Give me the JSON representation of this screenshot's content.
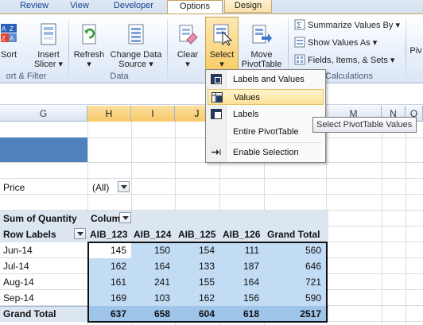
{
  "ribbon": {
    "tabs": [
      "Review",
      "View",
      "Developer",
      "Options",
      "Design"
    ],
    "buttons": {
      "sort": "Sort",
      "insert_slicer": [
        "Insert",
        "Slicer ▾"
      ],
      "refresh": [
        "Refresh",
        "▾"
      ],
      "change_data_source": [
        "Change Data",
        "Source ▾"
      ],
      "clear": [
        "Clear",
        "▾"
      ],
      "select": [
        "Select",
        "▾"
      ],
      "move_pivottable": [
        "Move",
        "PivotTable"
      ],
      "summarize_values_by": "Summarize Values By ▾",
      "show_values_as": "Show Values As ▾",
      "fields_items_sets": "Fields, Items, & Sets ▾",
      "cut_off_right": "Piv"
    },
    "groups": {
      "sort_filter": "ort & Filter",
      "data": "Data",
      "calculations": "Calculations"
    }
  },
  "columns": [
    "G",
    "H",
    "I",
    "J",
    "M",
    "N",
    "O"
  ],
  "select_menu": {
    "items": [
      "Labels and Values",
      "Values",
      "Labels",
      "Entire PivotTable",
      "Enable Selection"
    ],
    "highlighted": "Values"
  },
  "tooltip": "Select PivotTable Values",
  "pivot": {
    "filter_label": "Price",
    "filter_value": "(All)",
    "sum_label": "Sum of Quantity",
    "col_labels": "Colum",
    "row_labels": "Row Labels",
    "headers": [
      "AIB_123",
      "AIB_124",
      "AIB_125",
      "AIB_126",
      "Grand Total"
    ],
    "rows": [
      {
        "label": "Jun-14",
        "values": [
          "145",
          "150",
          "154",
          "111",
          "560"
        ]
      },
      {
        "label": "Jul-14",
        "values": [
          "162",
          "164",
          "133",
          "187",
          "646"
        ]
      },
      {
        "label": "Aug-14",
        "values": [
          "161",
          "241",
          "155",
          "164",
          "721"
        ]
      },
      {
        "label": "Sep-14",
        "values": [
          "169",
          "103",
          "162",
          "156",
          "590"
        ]
      }
    ],
    "grand_total_label": "Grand Total",
    "grand_totals": [
      "637",
      "658",
      "604",
      "618",
      "2517"
    ]
  },
  "colors": {
    "selection_fill": "#c2dcf4",
    "header_band": "#dce6f1",
    "menu_highlight": "#fbe29a",
    "context_tab": "#f8e3ac"
  }
}
